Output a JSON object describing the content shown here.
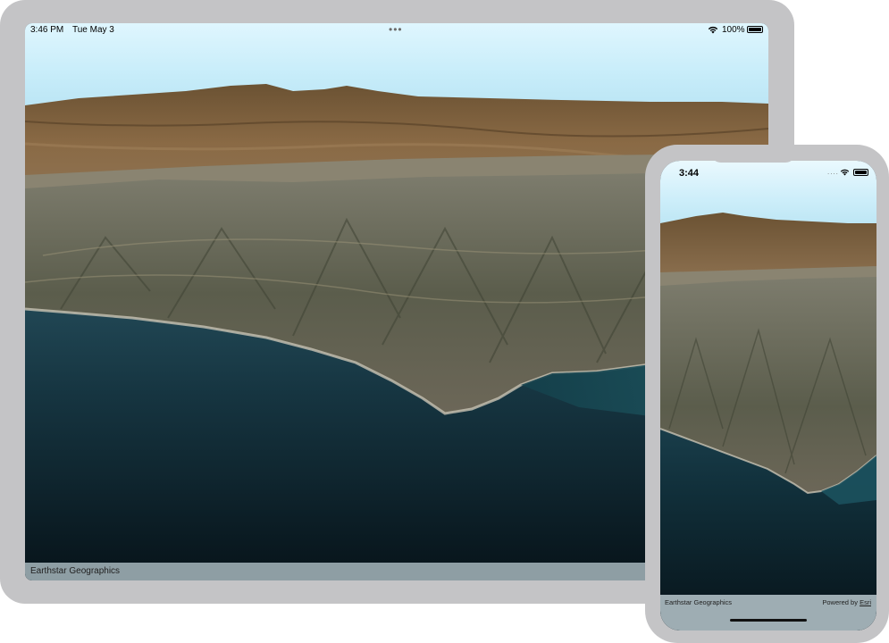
{
  "ipad": {
    "status": {
      "time": "3:46 PM",
      "date": "Tue May 3",
      "multitask": "•••",
      "battery": "100%"
    },
    "attribution": "Earthstar Geographics"
  },
  "iphone": {
    "status": {
      "time": "3:44",
      "dots": "...."
    },
    "attribution": {
      "left": "Earthstar Geographics",
      "powered_by": "Powered by ",
      "esri": "Esri"
    }
  },
  "icons": [
    "wifi-icon",
    "battery-icon",
    "home-indicator"
  ],
  "colors": {
    "device_frame": "#c4c4c6",
    "sky": "#c6ecf9",
    "ocean": "#0a1c24",
    "attribution_bar": "#8e9ea4"
  }
}
